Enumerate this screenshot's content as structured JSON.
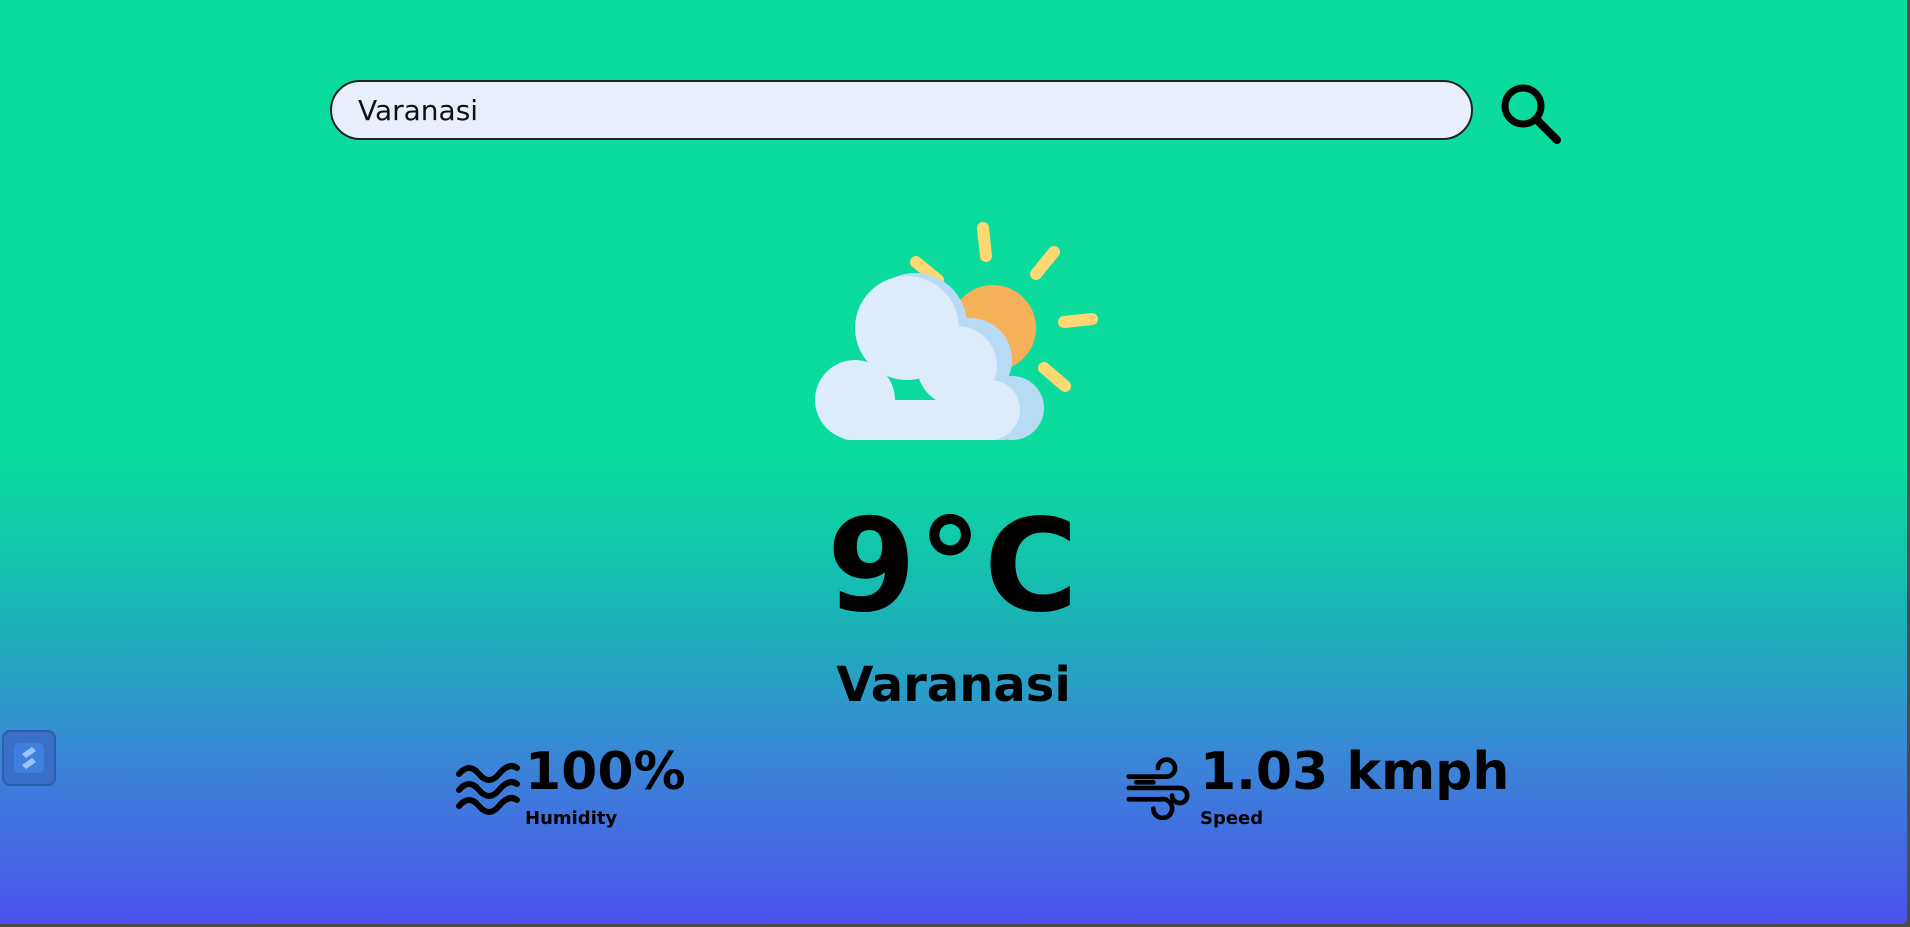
{
  "search": {
    "value": "Varanasi",
    "button_icon": "search-icon"
  },
  "weather": {
    "condition_icon": "partly-cloudy-icon",
    "temperature": "9°C",
    "city": "Varanasi"
  },
  "stats": {
    "humidity": {
      "icon": "waves-icon",
      "value": "100%",
      "label": "Humidity"
    },
    "wind": {
      "icon": "wind-icon",
      "value": "1.03 kmph",
      "label": "Speed"
    }
  },
  "colors": {
    "gradient_top": "#0bdc9e",
    "gradient_bottom": "#4b52ee",
    "search_bg": "#e8eefb",
    "sun": "#f6b15a",
    "sun_rays": "#ffd873",
    "cloud": "#dcecfb",
    "cloud_shadow": "#b8dbf5"
  },
  "side_widget": {
    "icon": "extension-icon"
  }
}
